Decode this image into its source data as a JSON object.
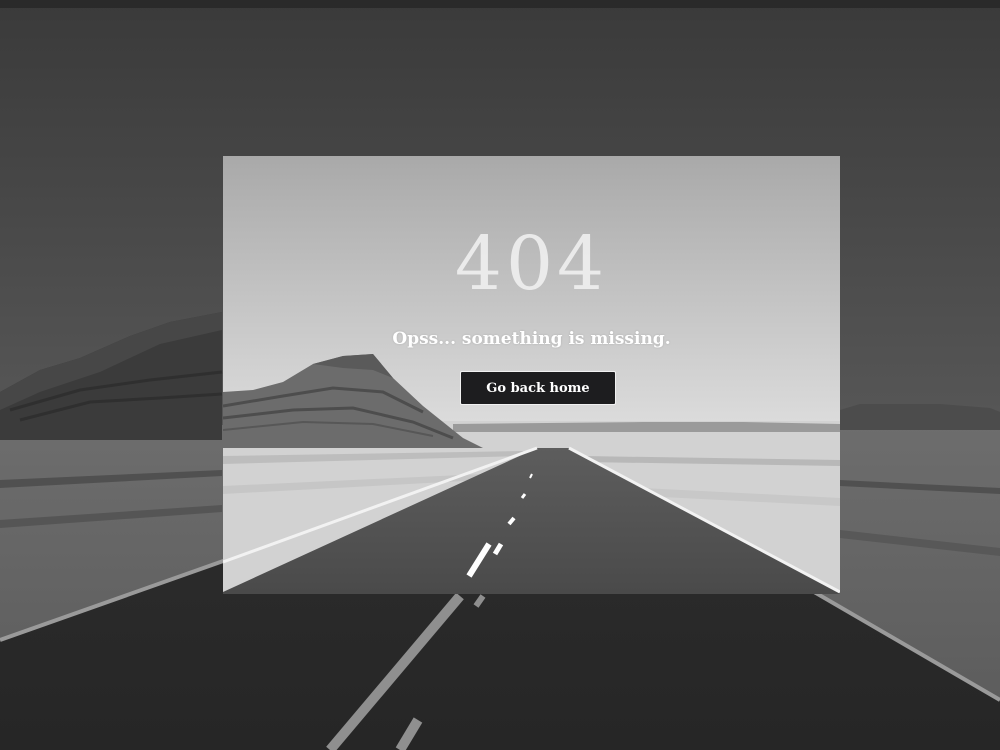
{
  "error_page": {
    "code": "404",
    "message": "Opss... something is missing.",
    "home_button_label": "Go back home"
  },
  "background": {
    "scene": "grayscale desert road with butte",
    "outer_overlay_color": "#000000",
    "panel_style": "lighter window over the same photo"
  }
}
